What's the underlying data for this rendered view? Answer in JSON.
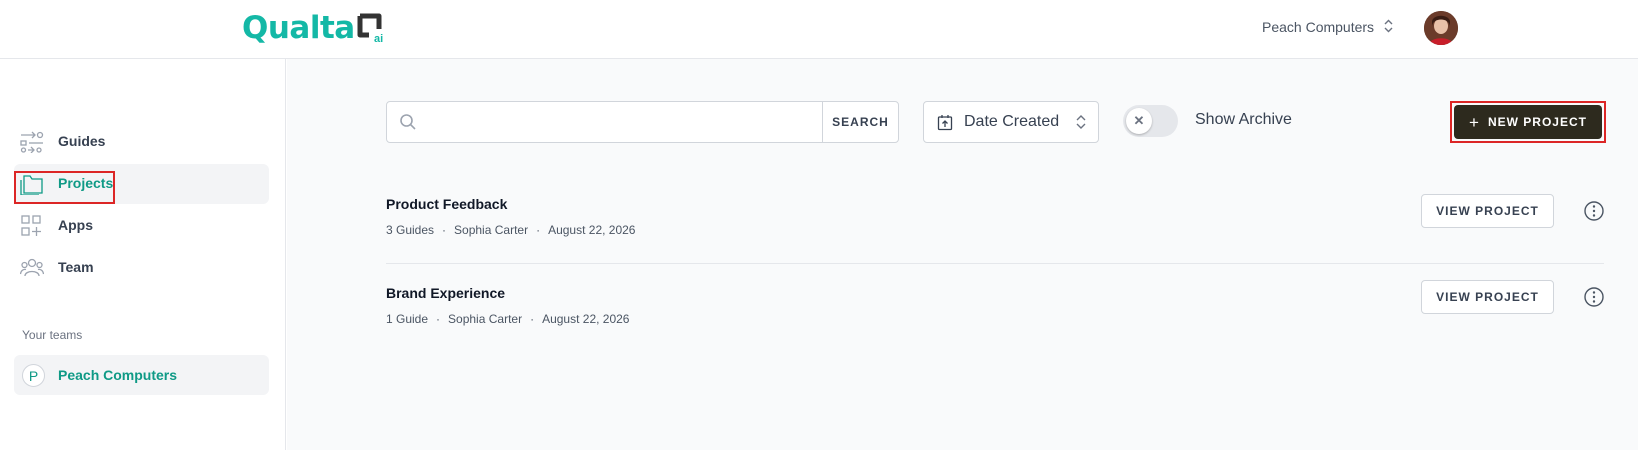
{
  "header": {
    "logo_text": "Qualta",
    "logo_sub": "ai",
    "org_name": "Peach Computers"
  },
  "sidebar": {
    "items": [
      {
        "label": "Guides",
        "icon": "guides-icon"
      },
      {
        "label": "Projects",
        "icon": "folder-icon",
        "active": true
      },
      {
        "label": "Apps",
        "icon": "apps-icon"
      },
      {
        "label": "Team",
        "icon": "team-icon"
      }
    ],
    "teams_heading": "Your teams",
    "team": {
      "badge": "P",
      "label": "Peach Computers"
    }
  },
  "toolbar": {
    "search_placeholder": "",
    "search_label": "SEARCH",
    "sort_label": "Date Created",
    "archive_label": "Show Archive",
    "archive_on": false,
    "new_project_label": "NEW PROJECT"
  },
  "projects": [
    {
      "title": "Product Feedback",
      "guides": "3 Guides",
      "owner": "Sophia Carter",
      "date": "August 22, 2026",
      "action": "VIEW PROJECT"
    },
    {
      "title": "Brand Experience",
      "guides": "1 Guide",
      "owner": "Sophia Carter",
      "date": "August 22, 2026",
      "action": "VIEW PROJECT"
    }
  ],
  "colors": {
    "accent": "#14b8a6",
    "active_text": "#0f9a86",
    "primary_button": "#2d2a1e",
    "highlight": "#dc2626"
  }
}
